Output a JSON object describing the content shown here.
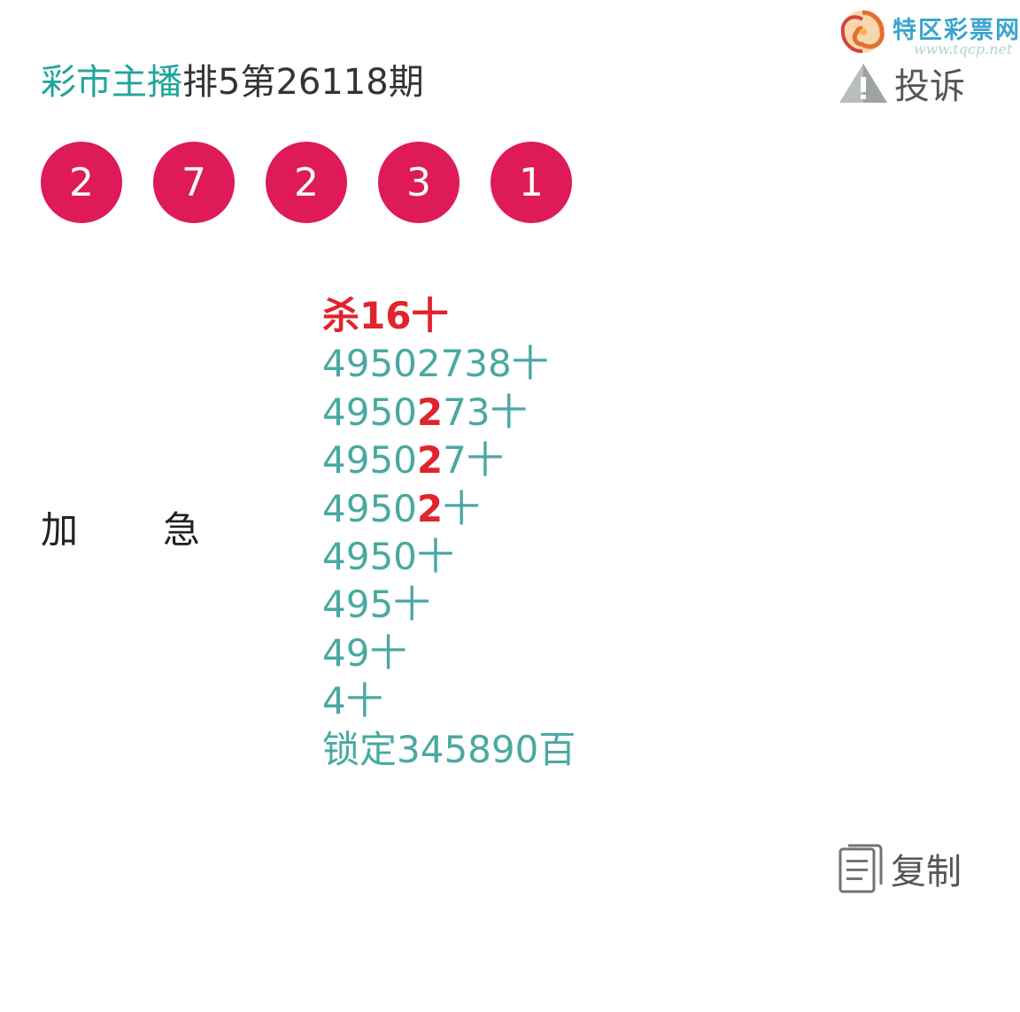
{
  "watermark": {
    "name": "特区彩票网",
    "url": "www.tqcp.net"
  },
  "header": {
    "source": "彩市主播",
    "issue": "排5第26118期",
    "complain_label": "投诉"
  },
  "balls": [
    "2",
    "7",
    "2",
    "3",
    "1"
  ],
  "ball_color": "#de1a58",
  "side_labels": [
    "加",
    "急"
  ],
  "content_lines": [
    {
      "pre": "杀16十",
      "hl": "",
      "post": ""
    },
    {
      "pre": "49502738十",
      "hl": "",
      "post": ""
    },
    {
      "pre": "4950",
      "hl": "2",
      "post": "73十"
    },
    {
      "pre": "4950",
      "hl": "2",
      "post": "7十"
    },
    {
      "pre": "4950",
      "hl": "2",
      "post": "十"
    },
    {
      "pre": "4950十",
      "hl": "",
      "post": ""
    },
    {
      "pre": "495十",
      "hl": "",
      "post": ""
    },
    {
      "pre": "49十",
      "hl": "",
      "post": ""
    },
    {
      "pre": "4十",
      "hl": "",
      "post": ""
    },
    {
      "pre": "锁定345890百",
      "hl": "",
      "post": ""
    }
  ],
  "copy_label": "复制",
  "colors": {
    "accent_teal": "#1fa69a",
    "text_teal": "#4aa9a1",
    "highlight_red": "#e0242e"
  },
  "icons": {
    "logo": "swirl-logo-icon",
    "complain": "warning-icon",
    "copy": "copy-document-icon"
  }
}
